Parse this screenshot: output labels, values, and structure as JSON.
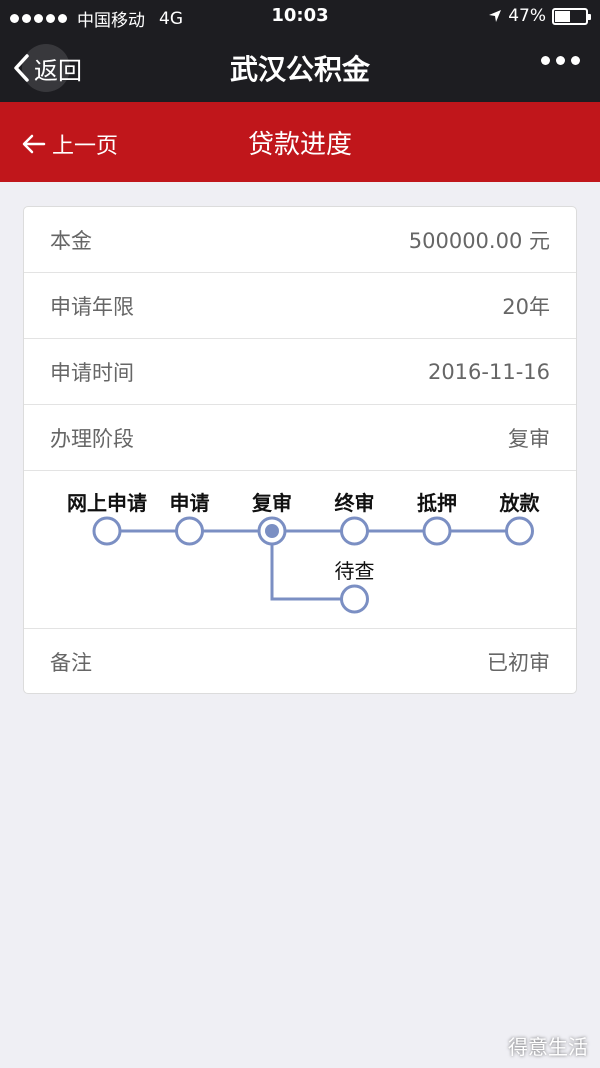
{
  "status_bar": {
    "carrier": "中国移动",
    "network": "4G",
    "time": "10:03",
    "battery": "47%",
    "battery_level": 0.47
  },
  "nav": {
    "back_label": "返回",
    "title": "武汉公积金",
    "more_icon": "more-dots-icon"
  },
  "header": {
    "prev_label": "上一页",
    "title": "贷款进度"
  },
  "details": {
    "principal_label": "本金",
    "principal_value": "500000.00 元",
    "term_label": "申请年限",
    "term_value": "20年",
    "date_label": "申请时间",
    "date_value": "2016-11-16",
    "stage_label": "办理阶段",
    "stage_value": "复审",
    "remark_label": "备注",
    "remark_value": "已初审"
  },
  "progress": {
    "steps": [
      "网上申请",
      "申请",
      "复审",
      "终审",
      "抵押",
      "放款"
    ],
    "current_step": 2,
    "branch_label": "待查"
  },
  "watermark": "得意生活",
  "colors": {
    "header_red": "#c0161b",
    "nav_dark": "#1d1d21",
    "node_blue": "#7b8fc3"
  }
}
